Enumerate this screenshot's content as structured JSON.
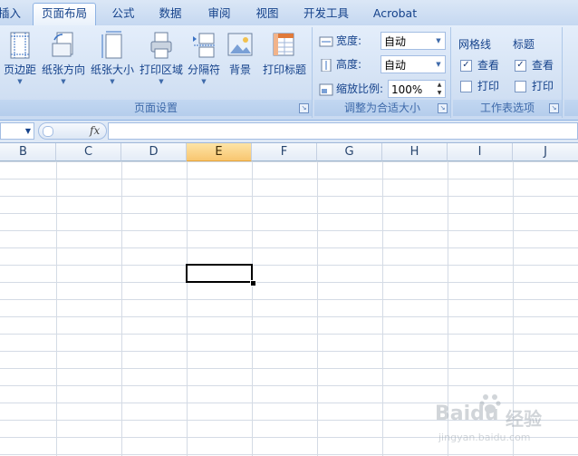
{
  "tabs": [
    {
      "label": "插入",
      "active": false
    },
    {
      "label": "页面布局",
      "active": true
    },
    {
      "label": "公式",
      "active": false
    },
    {
      "label": "数据",
      "active": false
    },
    {
      "label": "审阅",
      "active": false
    },
    {
      "label": "视图",
      "active": false
    },
    {
      "label": "开发工具",
      "active": false
    },
    {
      "label": "Acrobat",
      "active": false
    }
  ],
  "ribbon": {
    "page_setup": {
      "title": "页面设置",
      "buttons": [
        {
          "label": "页边距",
          "icon": "margins-icon"
        },
        {
          "label": "纸张方向",
          "icon": "orientation-icon"
        },
        {
          "label": "纸张大小",
          "icon": "paper-size-icon"
        },
        {
          "label": "打印区域",
          "icon": "print-area-icon"
        },
        {
          "label": "分隔符",
          "icon": "breaks-icon"
        },
        {
          "label": "背景",
          "icon": "background-icon"
        },
        {
          "label": "打印标题",
          "icon": "print-titles-icon"
        }
      ]
    },
    "scale_to_fit": {
      "title": "调整为合适大小",
      "width_label": "宽度:",
      "width_value": "自动",
      "height_label": "高度:",
      "height_value": "自动",
      "scale_label": "缩放比例:",
      "scale_value": "100%"
    },
    "sheet_options": {
      "title": "工作表选项",
      "gridlines_label": "网格线",
      "headings_label": "标题",
      "view_label": "查看",
      "print_label": "打印",
      "gridlines_view": true,
      "gridlines_print": false,
      "headings_view": true,
      "headings_print": false
    }
  },
  "formula_bar": {
    "fx": "fx",
    "value": ""
  },
  "columns": [
    "B",
    "C",
    "D",
    "E",
    "F",
    "G",
    "H",
    "I",
    "J"
  ],
  "selected_column": "E",
  "watermark": {
    "brand": "Baidu",
    "suffix": "经验",
    "url": "jingyan.baidu.com"
  }
}
